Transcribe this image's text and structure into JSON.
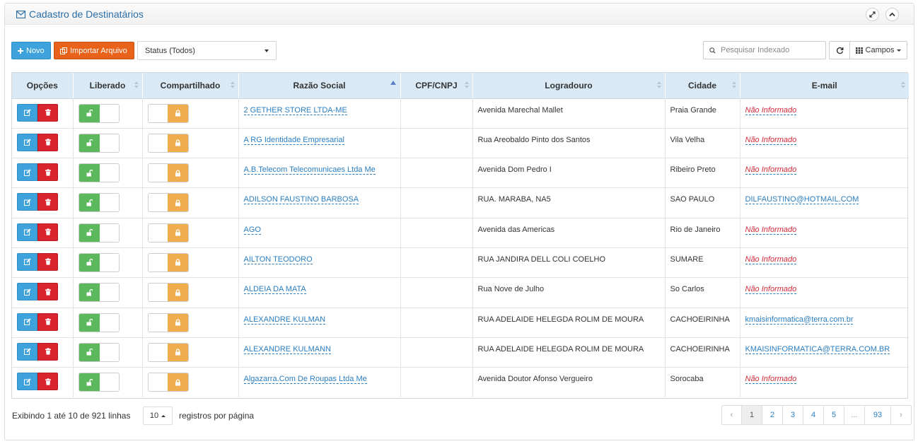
{
  "panel": {
    "title": "Cadastro de Destinatários",
    "title_icon": "envelope-icon",
    "expand_icon": "expand-icon",
    "collapse_icon": "chevron-up-icon"
  },
  "toolbar": {
    "novo_label": "Novo",
    "import_label": "Importar Arquivo",
    "status_value": "Status (Todos)",
    "search_placeholder": "Pesquisar Indexado",
    "campos_label": "Campos"
  },
  "colors": {
    "primary": "#3ea3dc",
    "danger": "#d9232d",
    "import": "#e8621a",
    "success": "#5cb85c",
    "warning": "#f0ad4e",
    "header_bg": "#d9eaf6"
  },
  "table": {
    "columns": [
      "Opções",
      "Liberado",
      "Compartilhado",
      "Razão Social",
      "CPF/CNPJ",
      "Logradouro",
      "Cidade",
      "E-mail"
    ],
    "rows": [
      {
        "razao": "2 GETHER STORE LTDA-ME",
        "cpf": "",
        "logradouro": "Avenida Marechal Mallet",
        "cidade": "Praia Grande",
        "email": "Não Informado",
        "email_missing": true
      },
      {
        "razao": "A RG Identidade Empresarial",
        "cpf": "",
        "logradouro": "Rua Areobaldo Pinto dos Santos",
        "cidade": "Vila Velha",
        "email": "Não Informado",
        "email_missing": true
      },
      {
        "razao": "A.B.Telecom Telecomunicaes Ltda Me",
        "cpf": "",
        "logradouro": "Avenida Dom Pedro I",
        "cidade": "Ribeiro Preto",
        "email": "Não Informado",
        "email_missing": true
      },
      {
        "razao": "ADILSON FAUSTINO BARBOSA",
        "cpf": "",
        "logradouro": "RUA. MARABA, NA5",
        "cidade": "SAO PAULO",
        "email": "DILFAUSTINO@HOTMAIL.COM",
        "email_missing": false
      },
      {
        "razao": "AGO",
        "cpf": "",
        "logradouro": "Avenida das Americas",
        "cidade": "Rio de Janeiro",
        "email": "Não Informado",
        "email_missing": true
      },
      {
        "razao": "AILTON TEODORO",
        "cpf": "",
        "logradouro": "RUA JANDIRA DELL COLI COELHO",
        "cidade": "SUMARE",
        "email": "Não Informado",
        "email_missing": true
      },
      {
        "razao": "ALDEIA DA MATA",
        "cpf": "",
        "logradouro": "Rua Nove de Julho",
        "cidade": "So Carlos",
        "email": "Não Informado",
        "email_missing": true
      },
      {
        "razao": "ALEXANDRE KULMAN",
        "cpf": "",
        "logradouro": "RUA ADELAIDE HELEGDA ROLIM DE MOURA",
        "cidade": "CACHOEIRINHA",
        "email": "kmaisinformatica@terra.com.br",
        "email_missing": false
      },
      {
        "razao": "ALEXANDRE KULMANN",
        "cpf": "",
        "logradouro": "RUA ADELAIDE HELEGDA ROLIM DE MOURA",
        "cidade": "CACHOEIRINHA",
        "email": "KMAISINFORMATICA@TERRA.COM.BR",
        "email_missing": false
      },
      {
        "razao": "Algazarra.Com De Roupas Ltda Me",
        "cpf": "",
        "logradouro": "Avenida Doutor Afonso Vergueiro",
        "cidade": "Sorocaba",
        "email": "Não Informado",
        "email_missing": true
      }
    ]
  },
  "footer": {
    "showing": "Exibindo 1 até 10 de 921 linhas",
    "per_page_value": "10",
    "per_page_suffix": "registros por página",
    "pages": [
      "‹",
      "1",
      "2",
      "3",
      "4",
      "5",
      "...",
      "93",
      "›"
    ],
    "active_page": "1"
  }
}
